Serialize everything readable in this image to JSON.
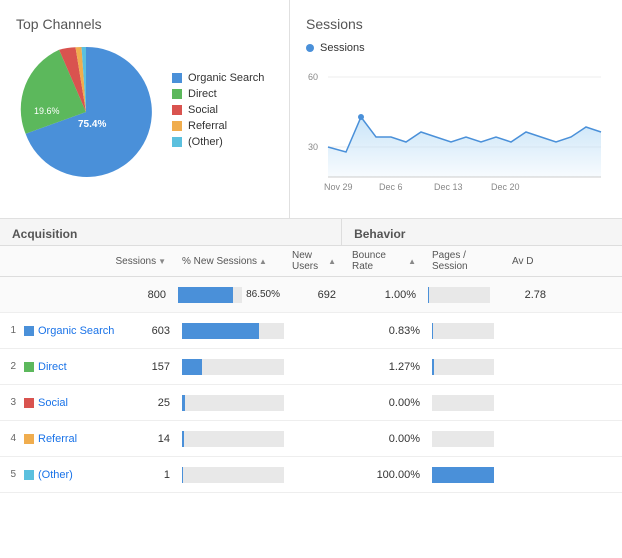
{
  "topChannels": {
    "title": "Top Channels",
    "pieData": [
      {
        "label": "Organic Search",
        "color": "#4a90d9",
        "pct": 75.4,
        "startAngle": 0,
        "endAngle": 271.44
      },
      {
        "label": "Direct",
        "color": "#5cb85c",
        "pct": 19.6,
        "startAngle": 271.44,
        "endAngle": 342.0
      },
      {
        "label": "Social",
        "color": "#d9534f",
        "pct": 2.5,
        "startAngle": 342.0,
        "endAngle": 351.0
      },
      {
        "label": "Referral",
        "color": "#f0ad4e",
        "pct": 1.5,
        "startAngle": 351.0,
        "endAngle": 356.4
      },
      {
        "label": "(Other)",
        "color": "#5bc0de",
        "pct": 1.0,
        "startAngle": 356.4,
        "endAngle": 360.0
      }
    ],
    "labels": {
      "pct756": "75.4%",
      "pct196": "19.6%"
    }
  },
  "sessions": {
    "title": "Sessions",
    "dotLabel": "Sessions",
    "yLabels": [
      "60",
      "30"
    ],
    "xLabels": [
      "Nov 29",
      "Dec 6",
      "Dec 13",
      "Dec 20"
    ]
  },
  "acquisition": {
    "title": "Acquisition",
    "behavior": "Behavior",
    "cols": {
      "sessions": "Sessions",
      "pctNew": "% New Sessions",
      "newUsers": "New Users",
      "bounceRate": "Bounce Rate",
      "pages": "Pages / Session",
      "avg": "Av D"
    },
    "summary": {
      "sessions": "800",
      "pctNew": "86.50%",
      "newUsers": "692",
      "bounceRate": "1.00%",
      "pages": "2.78"
    },
    "rows": [
      {
        "num": "1",
        "label": "Organic Search",
        "color": "#4a90d9",
        "sessions": 603,
        "pctNewBar": 75,
        "newUsers": "",
        "bounceRate": "0.83%",
        "bounceBar": 2,
        "pages": ""
      },
      {
        "num": "2",
        "label": "Direct",
        "color": "#5cb85c",
        "sessions": 157,
        "pctNewBar": 20,
        "newUsers": "",
        "bounceRate": "1.27%",
        "bounceBar": 3,
        "pages": ""
      },
      {
        "num": "3",
        "label": "Social",
        "color": "#d9534f",
        "sessions": 25,
        "pctNewBar": 3,
        "newUsers": "",
        "bounceRate": "0.00%",
        "bounceBar": 0,
        "pages": ""
      },
      {
        "num": "4",
        "label": "Referral",
        "color": "#f0ad4e",
        "sessions": 14,
        "pctNewBar": 2,
        "newUsers": "",
        "bounceRate": "0.00%",
        "bounceBar": 0,
        "pages": ""
      },
      {
        "num": "5",
        "label": "(Other)",
        "color": "#5bc0de",
        "sessions": 1,
        "pctNewBar": 1,
        "newUsers": "",
        "bounceRate": "100.00%",
        "bounceBar": 100,
        "pages": ""
      }
    ]
  }
}
